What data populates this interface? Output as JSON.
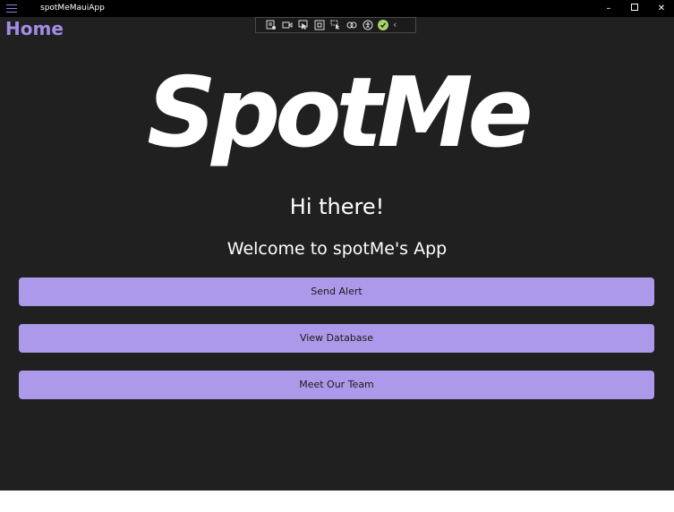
{
  "window": {
    "app_title": "spotMeMauiApp",
    "controls": {
      "minimize": "–",
      "close": "✕"
    }
  },
  "header": {
    "page_title": "Home"
  },
  "debug_toolbar": {
    "icons": [
      "live-visual-tree-icon",
      "record-video-icon",
      "select-element-icon",
      "display-layout-adorners-icon",
      "track-focused-element-icon",
      "binding-failures-icon",
      "accessibility-icon",
      "ok-status-icon",
      "collapse-chevron-icon"
    ],
    "chevron": "‹"
  },
  "logo": {
    "text": "SpotMe"
  },
  "main": {
    "greeting": "Hi there!",
    "welcome": "Welcome to spotMe's App",
    "buttons": [
      {
        "label": "Send Alert"
      },
      {
        "label": "View Database"
      },
      {
        "label": "Meet Our Team"
      }
    ]
  },
  "colors": {
    "background": "#202020",
    "titlebar": "#000000",
    "accent": "#a58be8",
    "button": "#ac99ea",
    "text": "#ffffff"
  }
}
